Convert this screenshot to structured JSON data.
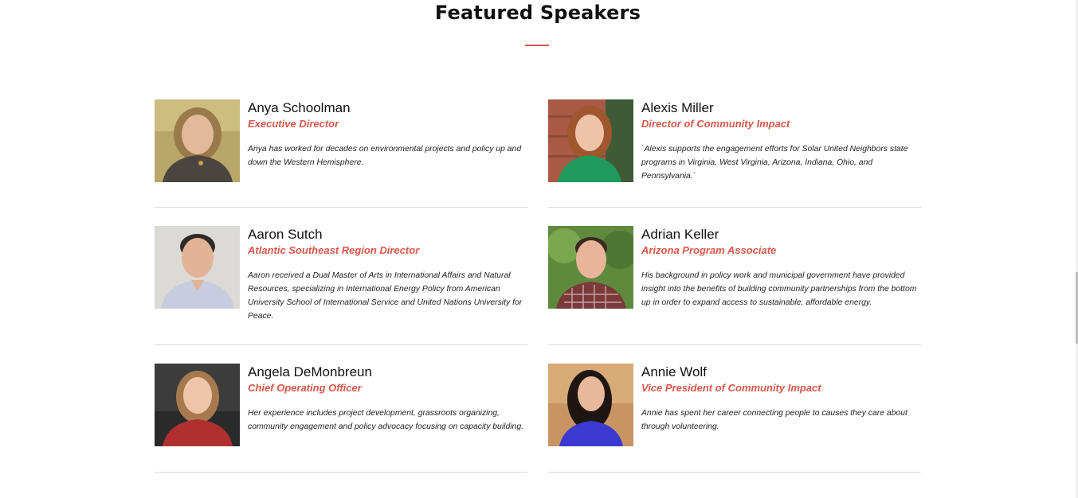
{
  "section": {
    "title": "Featured Speakers",
    "accent_color": "#d9574b"
  },
  "speakers": [
    {
      "name": "Anya Schoolman",
      "role": "Executive Director",
      "bio": "Anya has worked for decades on environmental projects and policy up and down the Western Hemisphere."
    },
    {
      "name": "Alexis Miller",
      "role": "Director of Community Impact",
      "bio": "`Alexis supports the engagement efforts for Solar United Neighbors state programs in Virginia, West Virginia, Arizona, Indiana, Ohio, and Pennsylvania.`"
    },
    {
      "name": "Aaron Sutch",
      "role": "Atlantic Southeast Region Director",
      "bio": "Aaron received a Dual Master of Arts in International Affairs and Natural Resources, specializing in International Energy Policy from American University School of International Service and United Nations University for Peace."
    },
    {
      "name": "Adrian Keller",
      "role": "Arizona Program Associate",
      "bio": "His background in policy work and municipal government have provided insight into the benefits of building community partnerships from the bottom up in order to expand access to sustainable, affordable energy."
    },
    {
      "name": "Angela DeMonbreun",
      "role": "Chief Operating Officer",
      "bio": "Her experience includes project development, grassroots organizing, community engagement and policy advocacy focusing on capacity building."
    },
    {
      "name": "Annie Wolf",
      "role": "Vice President of Community Impact",
      "bio": "Annie has spent her career connecting people to causes they care about through volunteering."
    }
  ]
}
